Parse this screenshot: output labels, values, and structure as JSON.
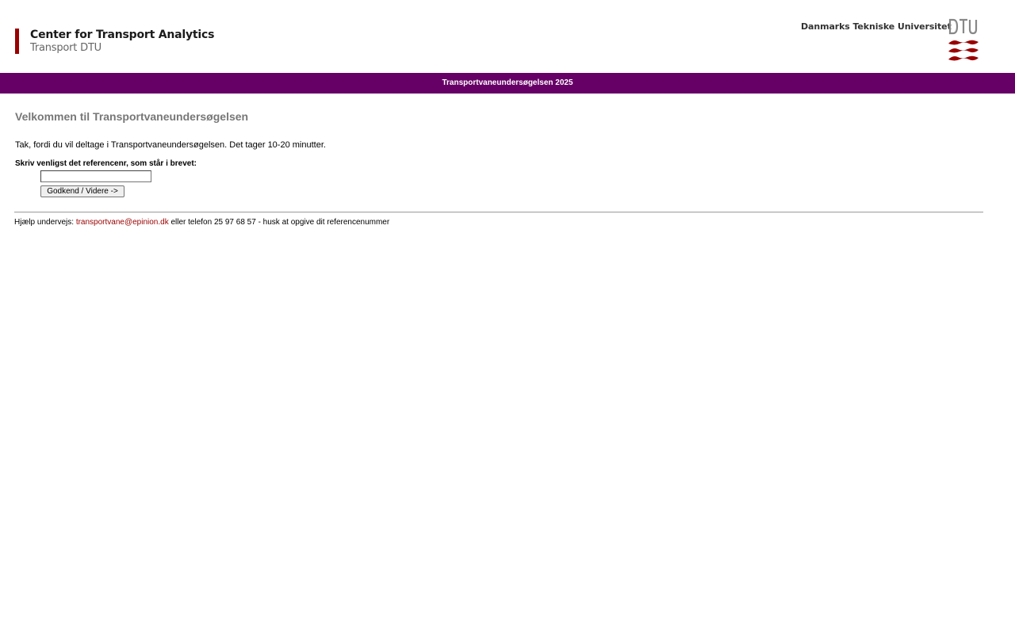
{
  "header": {
    "cta_logo": {
      "line1": "Center for Transport Analytics",
      "line2": "Transport DTU"
    },
    "university_name": "Danmarks Tekniske Universitet",
    "university_mark_text": "DTU"
  },
  "banner": {
    "title": "Transportvaneundersøgelsen 2025"
  },
  "main": {
    "heading": "Velkommen til Transportvaneundersøgelsen",
    "intro": "Tak, fordi du vil deltage i Transportvaneundersøgelsen. Det tager 10-20 minutter.",
    "reference_label": "Skriv venligst det referencenr, som står i brevet:",
    "reference_value": "",
    "submit_label": "Godkend / Videre ->"
  },
  "footer": {
    "prefix": "Hjælp undervejs: ",
    "email": "transportvane@epinion.dk",
    "suffix": " eller telefon 25 97 68 57 - husk at opgive dit referencenummer"
  },
  "colors": {
    "band": "#660066",
    "accent_red": "#990000",
    "heading_gray": "#777777"
  }
}
